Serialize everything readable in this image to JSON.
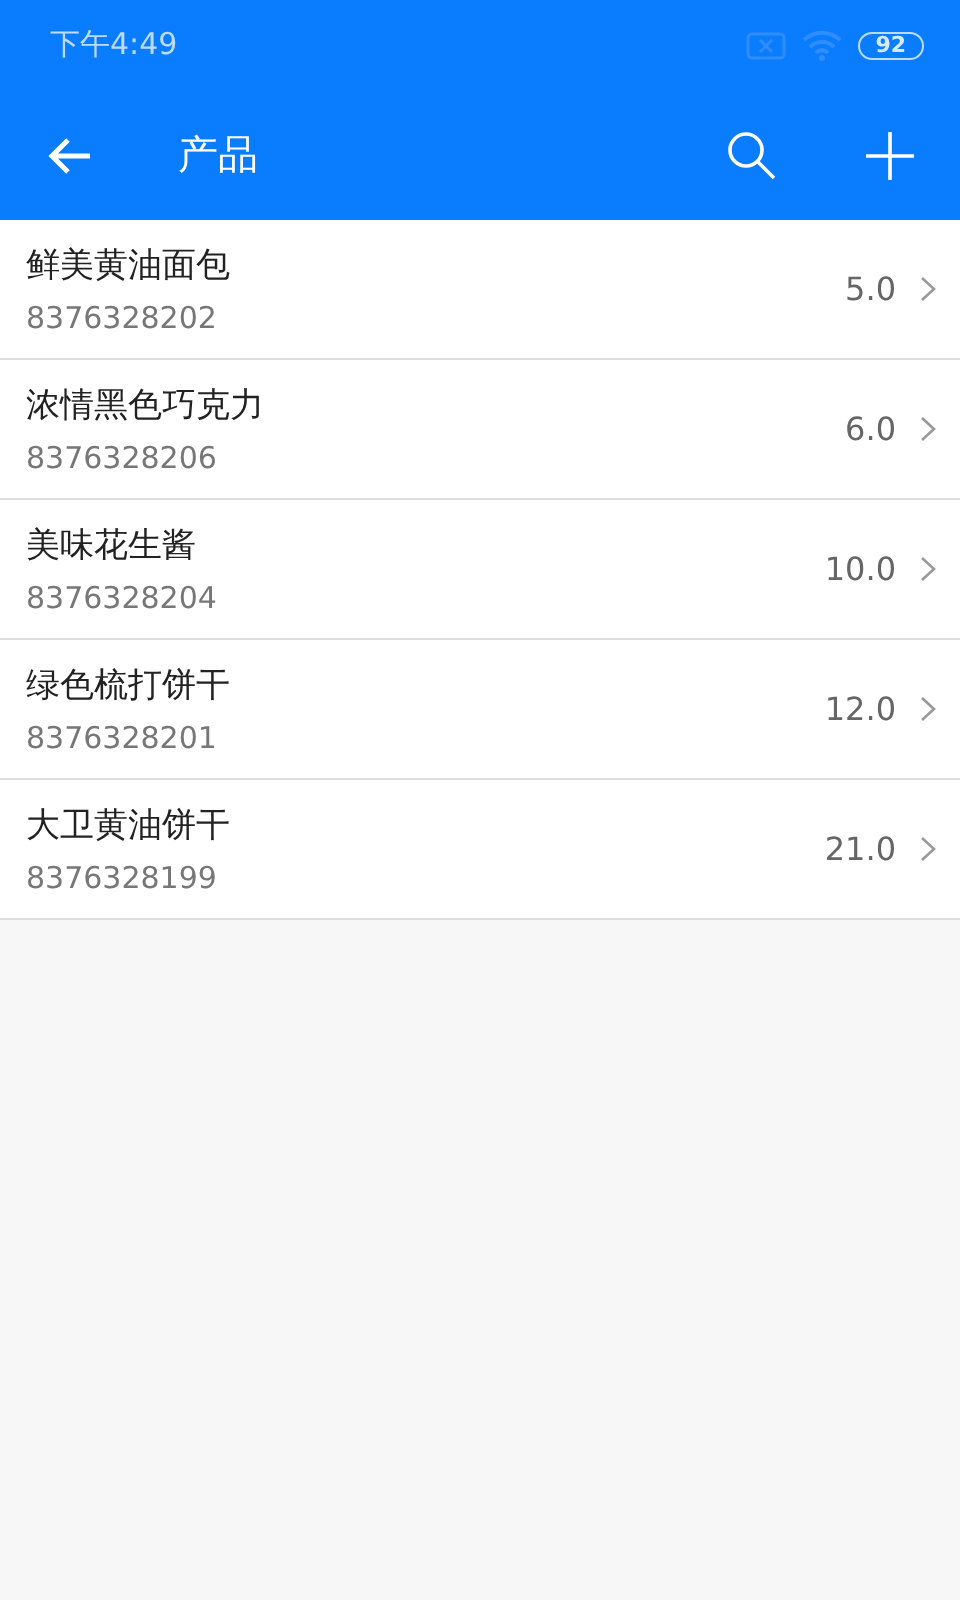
{
  "status_bar": {
    "time": "下午4:49",
    "battery": "92"
  },
  "toolbar": {
    "title": "产品"
  },
  "products": [
    {
      "name": "鲜美黄油面包",
      "code": "8376328202",
      "price": "5.0"
    },
    {
      "name": "浓情黑色巧克力",
      "code": "8376328206",
      "price": "6.0"
    },
    {
      "name": "美味花生酱",
      "code": "8376328204",
      "price": "10.0"
    },
    {
      "name": "绿色梳打饼干",
      "code": "8376328201",
      "price": "12.0"
    },
    {
      "name": "大卫黄油饼干",
      "code": "8376328199",
      "price": "21.0"
    }
  ]
}
